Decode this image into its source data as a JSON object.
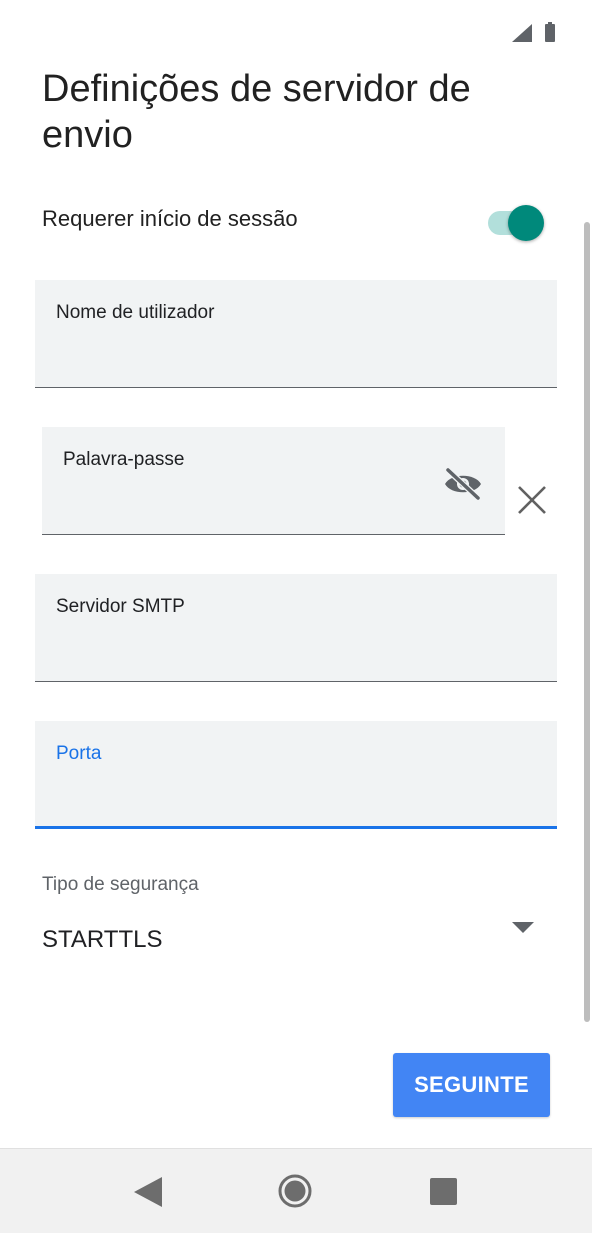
{
  "header": {
    "title": "Definições de servidor de envio"
  },
  "login": {
    "toggle_label": "Requerer início de sessão",
    "toggle_on": true
  },
  "fields": {
    "username_label": "Nome de utilizador",
    "password_label": "Palavra-passe",
    "smtp_label": "Servidor SMTP",
    "port_label": "Porta"
  },
  "security": {
    "label": "Tipo de segurança",
    "value": "STARTTLS"
  },
  "actions": {
    "next_label": "SEGUINTE"
  },
  "icons": {
    "password_visibility": "eye-off-icon",
    "clear": "close-icon",
    "dropdown": "chevron-down-icon",
    "nav_back": "back-icon",
    "nav_home": "home-icon",
    "nav_recents": "recents-icon"
  },
  "colors": {
    "accent": "#00897b",
    "focus": "#1a73e8",
    "button": "#4285f4"
  }
}
